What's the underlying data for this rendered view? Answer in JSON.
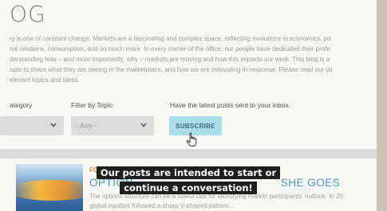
{
  "page": {
    "title": "OG",
    "intro_lines": [
      "ry is one of constant change. Markets are a fascinating and complex space, reflecting evolutions in economics, po",
      "nal relations, consumption, and so much more. In every corner of the office, our people have dedicated their profe",
      "derstanding how – and more importantly, why – markets are moving and how this impacts our work. This blog is a",
      "ople to share what they are seeing in the marketplace, and how we are innovating in response. Please read our lat",
      "elevant topics and ideas."
    ]
  },
  "filters": {
    "category_label": "ategory",
    "topic_label": "Filter by Topic",
    "topic_value": "- Any -",
    "subscribe_prompt": "Have the latest posts sent to your inbox.",
    "subscribe_label": "SUBSCRIBE"
  },
  "post": {
    "tag": "FQ",
    "title": "OPTION",
    "title_tail": "SHE GOES",
    "excerpt_lines": [
      "The options structure can be a useful tool for identifying market participants' outlook. In 20",
      "global equities followed a sharp V-shaped pattern..."
    ]
  },
  "caption": {
    "line1": "Our posts are intended to start or",
    "line2": "continue a conversation!"
  },
  "colors": {
    "subscribe_bg": "#a9dde8",
    "post_title": "#4a9bb5",
    "tag": "#e8893a",
    "caption_bg": "#1e1e1e"
  },
  "icons": {
    "dropdown": "chevron-down-icon",
    "pointer": "hand-cursor-icon"
  }
}
